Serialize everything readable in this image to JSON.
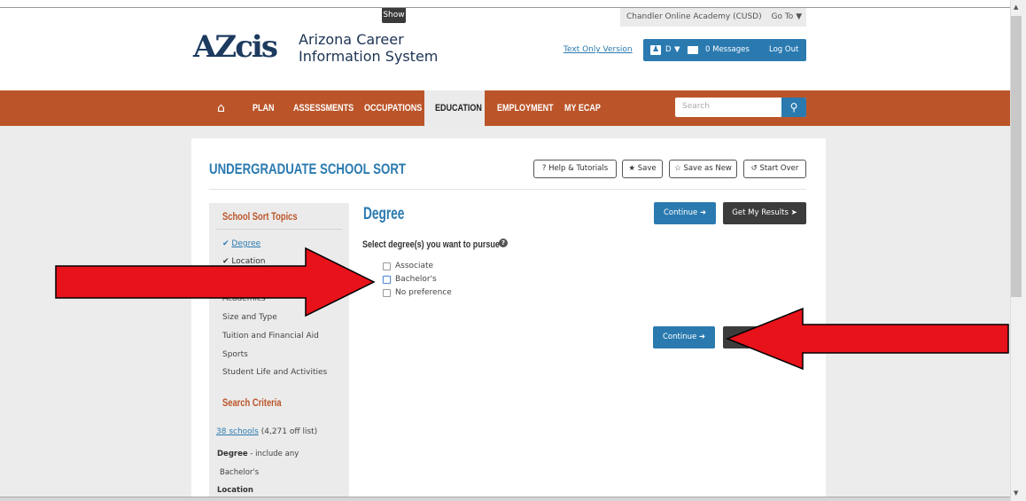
{
  "header": {
    "show_tab": "Show",
    "account_label": "Chandler Online Academy (CUSD)",
    "goto_label": "Go To",
    "logo_mark": "AZcis",
    "logo_text_line1": "Arizona Career",
    "logo_text_line2": "Information System",
    "text_only_link": "Text Only Version",
    "user_initial": "D",
    "messages_label": "0 Messages",
    "logout_label": "Log Out"
  },
  "nav": {
    "items": [
      "PLAN",
      "ASSESSMENTS",
      "OCCUPATIONS",
      "EDUCATION",
      "EMPLOYMENT",
      "MY ECAP"
    ],
    "active": "EDUCATION",
    "search_placeholder": "Search"
  },
  "page": {
    "title": "UNDERGRADUATE SCHOOL SORT",
    "toolbar": {
      "help": "Help & Tutorials",
      "save": "Save",
      "save_as_new": "Save as New",
      "start_over": "Start Over"
    }
  },
  "sidebar": {
    "topics_heading": "School Sort Topics",
    "topics": [
      "Degree",
      "Location",
      "Academics",
      "Size and Type",
      "Tuition and Financial Aid",
      "Sports",
      "Student Life and Activities"
    ],
    "criteria_heading": "Search Criteria",
    "schools_count": "38 schools",
    "off_list": "(4,271 off list)",
    "degree_criterion": "Degree",
    "degree_criterion_suffix": "- include any",
    "degree_value": "Bachelor's",
    "location_criterion": "Location"
  },
  "main": {
    "heading": "Degree",
    "question": "Select degree(s) you want to pursue",
    "options": [
      "Associate",
      "Bachelor's",
      "No preference"
    ],
    "continue_label": "Continue",
    "results_label": "Get My Results"
  },
  "colors": {
    "accent": "#2a7ab0",
    "nav": "#bb5529",
    "arrow": "#e8121b"
  }
}
